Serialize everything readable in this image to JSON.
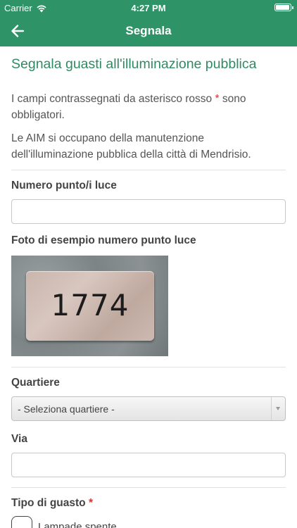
{
  "status_bar": {
    "carrier": "Carrier",
    "time": "4:27 PM",
    "battery_level": 0.95
  },
  "nav": {
    "title": "Segnala"
  },
  "page": {
    "title": "Segnala guasti all'illuminazione pubblica",
    "intro_text": "I campi contrassegnati da asterisco rosso ",
    "intro_asterisk": "*",
    "intro_suffix": " sono obbligatori.",
    "intro2": "Le AIM si occupano della manutenzione dell'illuminazione pubblica della città di Mendrisio."
  },
  "fields": {
    "numero_label": "Numero punto/i luce",
    "numero_value": "",
    "foto_label": "Foto di esempio numero punto luce",
    "foto_number": "1774",
    "quartiere_label": "Quartiere",
    "quartiere_selected": "- Seleziona quartiere -",
    "via_label": "Via",
    "via_value": "",
    "tipo_label": "Tipo di guasto",
    "tipo_asterisk": "*",
    "tipo_option_1": "Lampade spente"
  }
}
